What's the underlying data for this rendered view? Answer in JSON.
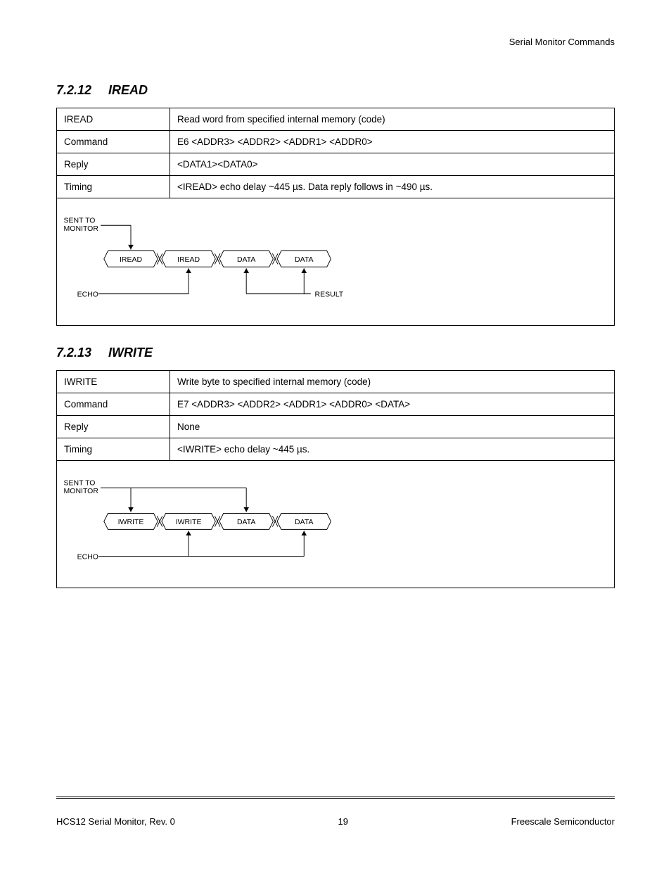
{
  "running_head": "Serial Monitor Commands",
  "sections": [
    {
      "number": "7.2.12",
      "title": "IREAD",
      "rows": [
        {
          "k": "IREAD",
          "v": "Read word from specified internal memory (code)"
        },
        {
          "k": "Command",
          "v": "E6 <ADDR3> <ADDR2> <ADDR1> <ADDR0>"
        },
        {
          "k": "Reply",
          "v": "<DATA1><DATA0>"
        },
        {
          "k": "Timing",
          "v": "<IREAD> echo delay ~445 µs. Data reply follows in ~490 µs."
        }
      ],
      "timing": {
        "sent_label": "SENT TO\nMONITOR",
        "echo_label": "ECHO",
        "result_label": "RESULT",
        "has_result_label": true,
        "blocks": [
          "IREAD",
          "IREAD",
          "DATA",
          "DATA"
        ],
        "arrows": [
          {
            "from": "top",
            "to": 0
          },
          {
            "from": "bottom",
            "to": 1
          },
          {
            "from": "bottom",
            "to": 2,
            "result": true
          },
          {
            "from": "bottom",
            "to": 3,
            "result": true
          }
        ]
      }
    },
    {
      "number": "7.2.13",
      "title": "IWRITE",
      "rows": [
        {
          "k": "IWRITE",
          "v": "Write byte to specified internal memory (code)"
        },
        {
          "k": "Command",
          "v": "E7 <ADDR3> <ADDR2> <ADDR1> <ADDR0> <DATA>"
        },
        {
          "k": "Reply",
          "v": "None"
        },
        {
          "k": "Timing",
          "v": "<IWRITE> echo delay ~445 µs."
        }
      ],
      "timing": {
        "sent_label": "SENT TO\nMONITOR",
        "echo_label": "ECHO",
        "result_label": "",
        "has_result_label": false,
        "blocks": [
          "IWRITE",
          "IWRITE",
          "DATA",
          "DATA"
        ],
        "arrows": [
          {
            "from": "top",
            "to": 0
          },
          {
            "from": "bottom",
            "to": 1
          },
          {
            "from": "top",
            "to": 2
          },
          {
            "from": "bottom",
            "to": 3
          }
        ]
      }
    }
  ],
  "footer": {
    "left": "HCS12 Serial Monitor, Rev. 0",
    "right": "Freescale Semiconductor",
    "page": "19"
  }
}
